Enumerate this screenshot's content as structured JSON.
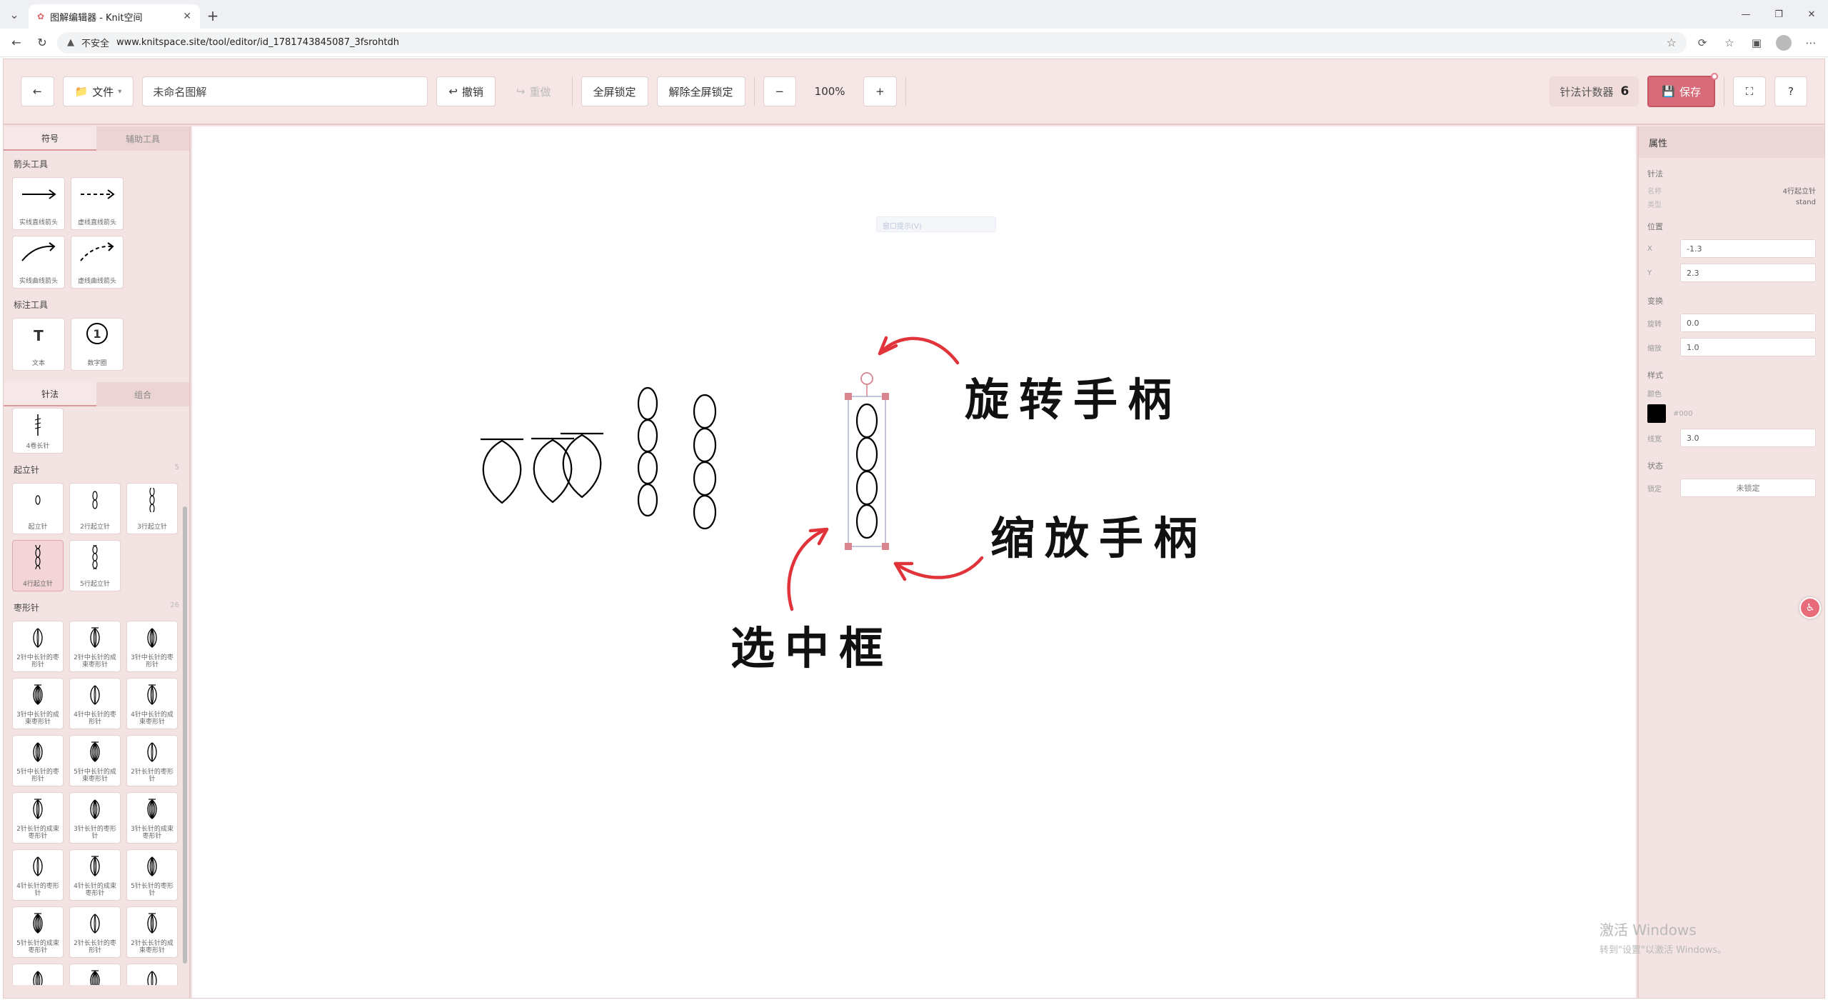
{
  "browser": {
    "tab_title": "图解编辑器 - Knit空间",
    "new_tab": "+",
    "insecure_label": "不安全",
    "url": "www.knitspace.site/tool/editor/id_1781743845087_3fsrohtdh"
  },
  "toolbar": {
    "back": "←",
    "file": "文件",
    "file_caret": "▾",
    "doc_name": "未命名图解",
    "undo": "撤销",
    "redo": "重做",
    "lock_all": "全屏锁定",
    "unlock_all": "解除全屏锁定",
    "zoom_out": "−",
    "zoom": "100%",
    "zoom_in": "+",
    "counter_label": "针法计数器",
    "counter_value": "6",
    "save": "保存",
    "fullscreen": "⛶",
    "help": "?"
  },
  "left_panel": {
    "tabs": [
      "符号",
      "辅助工具"
    ],
    "arrow_section": "箭头工具",
    "arrows": [
      "实线直线箭头",
      "虚线直线箭头",
      "实线曲线箭头",
      "虚线曲线箭头"
    ],
    "mark_section": "标注工具",
    "marks": [
      {
        "icon": "T",
        "label": "文本"
      },
      {
        "icon": "1",
        "label": "数字圈"
      }
    ],
    "tabs2": [
      "针法",
      "组合"
    ],
    "top_item": "4卷长针",
    "chain_section": "起立针",
    "chain_count": "5",
    "chains": [
      "起立针",
      "2行起立针",
      "3行起立针",
      "4行起立针",
      "5行起立针"
    ],
    "puff_section": "枣形针",
    "puff_count": "26",
    "puffs": [
      "2针中长针的枣形针",
      "2针中长针的成束枣形针",
      "3针中长针的枣形针",
      "3针中长针的成束枣形针",
      "4针中长针的枣形针",
      "4针中长针的成束枣形针",
      "5针中长针的枣形针",
      "5针中长针的成束枣形针",
      "2针长针的枣形针",
      "2针长针的成束枣形针",
      "3针长针的枣形针",
      "3针长针的成束枣形针",
      "4针长针的枣形针",
      "4针长针的成束枣形针",
      "5针长针的枣形针",
      "5针长针的成束枣形针",
      "2针长长针的枣形针",
      "2针长长针的成束枣形针",
      "",
      "",
      ""
    ]
  },
  "canvas": {
    "hint": "窗口提示(V)",
    "annotations": {
      "rotate": "旋转手柄",
      "scale": "缩放手柄",
      "select": "选中框"
    }
  },
  "right_panel": {
    "title": "属性",
    "stitch_section": "针法",
    "name_key": "名称",
    "name_val": "4行起立针",
    "type_key": "类型",
    "type_val": "stand",
    "position_section": "位置",
    "x_key": "X",
    "x_val": "-1.3",
    "y_key": "Y",
    "y_val": "2.3",
    "transform_section": "变换",
    "rotate_key": "旋转",
    "rotate_val": "0.0",
    "scale_key": "缩放",
    "scale_val": "1.0",
    "style_section": "样式",
    "color_key": "颜色",
    "color_val": "#000",
    "linewidth_key": "线宽",
    "linewidth_val": "3.0",
    "state_section": "状态",
    "lock_key": "锁定",
    "lock_val": "未锁定"
  },
  "watermark": {
    "line1": "激活 Windows",
    "line2": "转到\"设置\"以激活 Windows。"
  },
  "colors": {
    "accent": "#d86b7a",
    "annotation_red": "#e0333a",
    "handle": "#d9848f"
  }
}
